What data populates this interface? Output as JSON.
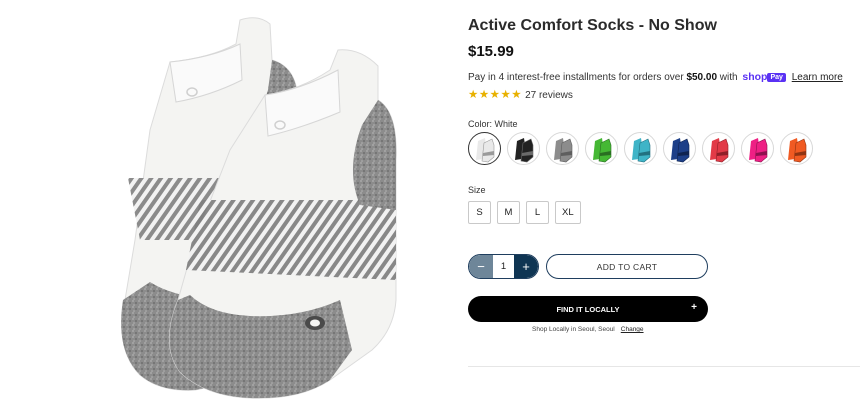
{
  "product": {
    "title": "Active Comfort Socks - No Show",
    "price": "$15.99"
  },
  "installments": {
    "text_prefix": "Pay in 4 interest-free installments for orders over ",
    "threshold": "$50.00",
    "text_suffix": " with ",
    "shop_word": "shop",
    "shop_pay_badge": "Pay",
    "learn_more": "Learn more"
  },
  "rating": {
    "stars": 5,
    "reviews_label": "27 reviews"
  },
  "color": {
    "label": "Color: White",
    "swatches": [
      {
        "name": "white",
        "hex": "#e9e9e9",
        "accent": "#9a9a9a",
        "selected": true
      },
      {
        "name": "black",
        "hex": "#222222",
        "accent": "#6a6a6a",
        "selected": false
      },
      {
        "name": "gray",
        "hex": "#8c8c8c",
        "accent": "#5e5e5e",
        "selected": false
      },
      {
        "name": "green",
        "hex": "#45b834",
        "accent": "#2a6f22",
        "selected": false
      },
      {
        "name": "teal",
        "hex": "#3fb4c7",
        "accent": "#227180",
        "selected": false
      },
      {
        "name": "navy",
        "hex": "#1d3f88",
        "accent": "#0f2350",
        "selected": false
      },
      {
        "name": "red",
        "hex": "#e23a47",
        "accent": "#8f1f28",
        "selected": false
      },
      {
        "name": "pink",
        "hex": "#ee1f84",
        "accent": "#8e114f",
        "selected": false
      },
      {
        "name": "orange",
        "hex": "#f05a22",
        "accent": "#913412",
        "selected": false
      }
    ]
  },
  "size": {
    "label": "Size",
    "options": [
      "S",
      "M",
      "L",
      "XL"
    ]
  },
  "quantity": {
    "minus": "−",
    "value": "1",
    "plus": "+"
  },
  "actions": {
    "add_to_cart": "ADD TO CART",
    "find_locally": "FIND IT LOCALLY",
    "find_plus": "+",
    "shop_locally": "Shop Locally in Seoul, Seoul",
    "change": "Change"
  },
  "colors": {
    "sock_white": "#f4f4f2",
    "sock_gray": "#8b8b8b",
    "accent_navy": "#0f3553",
    "star": "#e8b100",
    "shop_purple": "#5a31f4"
  }
}
